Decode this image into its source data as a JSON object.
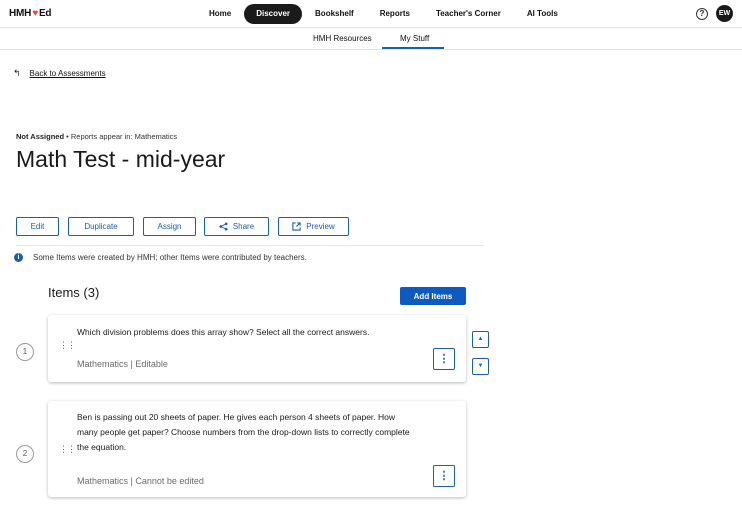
{
  "topnav": {
    "logo_left": "HMH",
    "logo_heart": "♥",
    "logo_right": "Ed",
    "links": [
      "Home",
      "Discover",
      "Bookshelf",
      "Reports",
      "Teacher's Corner",
      "AI Tools"
    ],
    "active": "Discover",
    "help_glyph": "?",
    "avatar_initials": "EW"
  },
  "subnav": {
    "hmh_resources": "HMH Resources",
    "my_stuff": "My Stuff"
  },
  "back": {
    "label": "Back to Assessments"
  },
  "meta": {
    "status": "Not Assigned",
    "separator": " • ",
    "reports": "Reports appear in: Mathematics"
  },
  "title": "Math Test - mid-year",
  "actions": {
    "edit": "Edit",
    "duplicate": "Duplicate",
    "assign": "Assign",
    "share": "Share",
    "preview": "Preview"
  },
  "info": {
    "text": "Some Items were created by HMH; other Items were contributed by teachers."
  },
  "items": {
    "heading": "Items (3)",
    "add_button": "Add Items",
    "list": [
      {
        "number": "1",
        "question": "Which division problems does this array show? Select all the correct answers.",
        "subtitle": "Mathematics | Editable"
      },
      {
        "number": "2",
        "question": "Ben is passing out 20 sheets of paper. He gives each person 4 sheets of paper. How many people get paper? Choose numbers from the drop-down lists to correctly complete the equation.",
        "subtitle": "Mathematics | Cannot be edited"
      }
    ]
  },
  "icons": {
    "back": "back-arrow-icon",
    "share": "share-icon",
    "preview": "external-link-icon",
    "info": "info-icon",
    "drag": "drag-handle-icon",
    "more": "kebab-menu-icon",
    "up": "arrow-up-icon",
    "down": "arrow-down-icon"
  },
  "colors": {
    "accent": "#1b5fa8",
    "primary_button": "#0d5bc1",
    "active_nav": "#1a1a1a",
    "logo_heart": "#e8463c"
  }
}
